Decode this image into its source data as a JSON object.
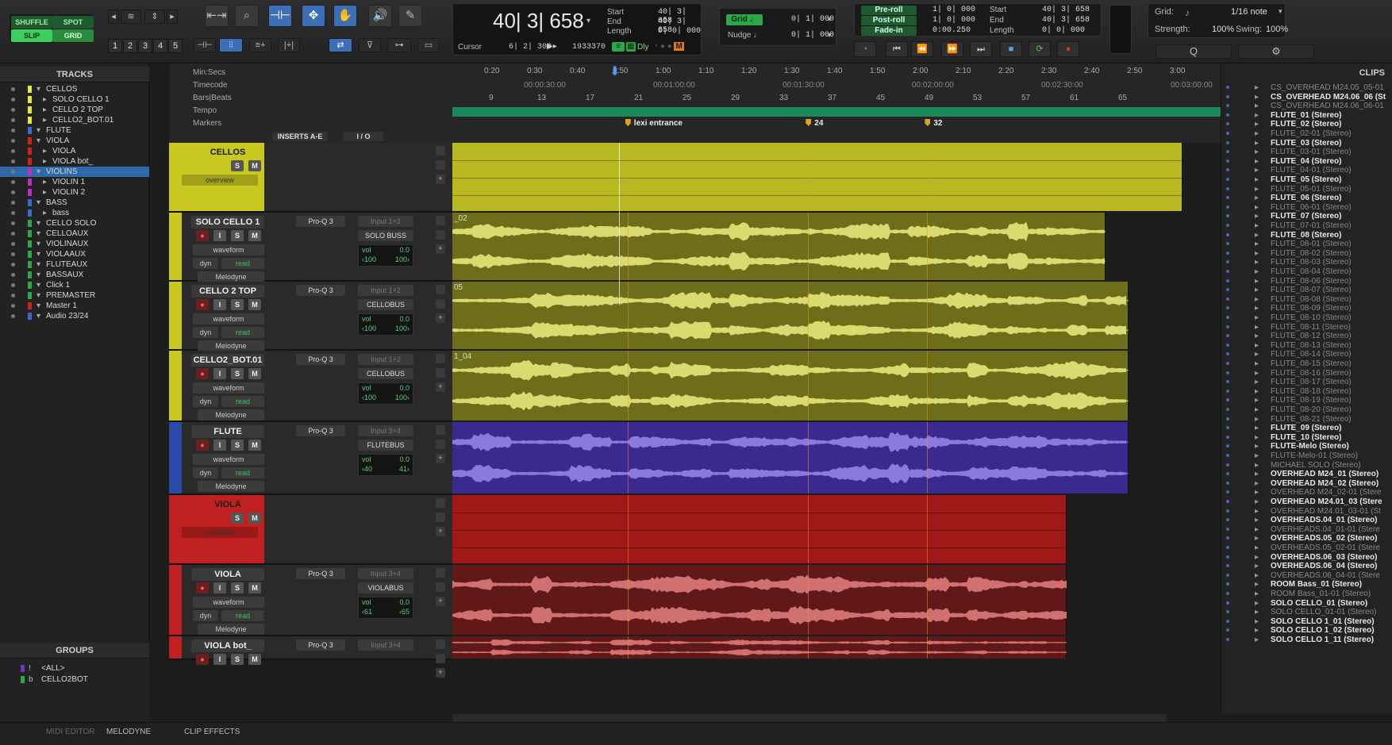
{
  "toolbar": {
    "modes": {
      "shuffle": "SHUFFLE",
      "spot": "SPOT",
      "slip": "SLIP",
      "grid": "GRID"
    },
    "zoom_presets": [
      "1",
      "2",
      "3",
      "4",
      "5"
    ],
    "main_counter": "40| 3| 658",
    "selection": {
      "start_label": "Start",
      "end_label": "End",
      "length_label": "Length",
      "start": "40| 3| 658",
      "end": "40| 3| 658",
      "length": "0| 0| 000"
    },
    "cursor_label": "Cursor",
    "cursor_value": "6| 2| 303",
    "cursor_samples": "1933370",
    "dly_label": "Dly",
    "grid_label": "Grid",
    "grid_value": "0| 1| 000",
    "nudge_label": "Nudge",
    "nudge_value": "0| 1| 000",
    "preroll_label": "Pre-roll",
    "postroll_label": "Post-roll",
    "fadein_label": "Fade-in",
    "preroll": "1| 0| 000",
    "postroll": "1| 0| 000",
    "fadein": "0:00.250",
    "transport_start_label": "Start",
    "transport_end_label": "End",
    "transport_length_label": "Length",
    "transport_start": "40| 3| 658",
    "transport_end": "40| 3| 658",
    "transport_length": "0| 0| 000",
    "grid_setting_label": "Grid:",
    "grid_setting_value": "1/16 note",
    "strength_label": "Strength:",
    "strength_value": "100%",
    "swing_label": "Swing:",
    "swing_value": "100%"
  },
  "tracks_panel": {
    "title": "TRACKS",
    "items": [
      {
        "name": "CELLOS",
        "color": "#e8e830",
        "indent": 0
      },
      {
        "name": "SOLO CELLO 1",
        "color": "#e8e830",
        "indent": 1
      },
      {
        "name": "CELLO 2 TOP",
        "color": "#e8e830",
        "indent": 1
      },
      {
        "name": "CELLO2_BOT.01",
        "color": "#e8e830",
        "indent": 1
      },
      {
        "name": "FLUTE",
        "color": "#3a6ad0",
        "indent": 0
      },
      {
        "name": "VIOLA",
        "color": "#d02020",
        "indent": 0
      },
      {
        "name": "VIOLA",
        "color": "#d02020",
        "indent": 1
      },
      {
        "name": "VIOLA bot_",
        "color": "#d02020",
        "indent": 1
      },
      {
        "name": "VIOLINS",
        "color": "#c030c0",
        "indent": 0,
        "selected": true
      },
      {
        "name": "VIOLIN 1",
        "color": "#c030c0",
        "indent": 1
      },
      {
        "name": "VIOLIN 2",
        "color": "#c030c0",
        "indent": 1
      },
      {
        "name": "BASS",
        "color": "#3a6ad0",
        "indent": 0
      },
      {
        "name": "bass",
        "color": "#3a6ad0",
        "indent": 1
      },
      {
        "name": "CELLO SOLO",
        "color": "#2aa84a",
        "indent": 0
      },
      {
        "name": "CELLOAUX",
        "color": "#2aa84a",
        "indent": 0
      },
      {
        "name": "VIOLINAUX",
        "color": "#2aa84a",
        "indent": 0
      },
      {
        "name": "VIOLAAUX",
        "color": "#2aa84a",
        "indent": 0
      },
      {
        "name": "FLUTEAUX",
        "color": "#2aa84a",
        "indent": 0
      },
      {
        "name": "BASSAUX",
        "color": "#2aa84a",
        "indent": 0
      },
      {
        "name": "Click 1",
        "color": "#2aa84a",
        "indent": 0
      },
      {
        "name": "PREMASTER",
        "color": "#2aa84a",
        "indent": 0
      },
      {
        "name": "Master 1",
        "color": "#d02020",
        "indent": 0
      },
      {
        "name": "Audio 23/24",
        "color": "#3a6ad0",
        "indent": 0
      }
    ]
  },
  "groups_panel": {
    "title": "GROUPS",
    "items": [
      {
        "key": "!",
        "name": "<ALL>",
        "color": "#7030d0"
      },
      {
        "key": "b",
        "name": "CELLO2BOT",
        "color": "#2aa84a"
      }
    ]
  },
  "rulers": {
    "labels": [
      "Min:Secs",
      "Timecode",
      "Bars|Beats",
      "Tempo",
      "Markers"
    ],
    "minsecs": [
      "0:20",
      "0:30",
      "0:40",
      "0:50",
      "1:00",
      "1:10",
      "1:20",
      "1:30",
      "1:40",
      "1:50",
      "2:00",
      "2:10",
      "2:20",
      "2:30",
      "2:40",
      "2:50",
      "3:00"
    ],
    "timecode": [
      "00:00:30:00",
      "00:01:00:00",
      "00:01:30:00",
      "00:02:00:00",
      "00:02:30:00",
      "00:03:00:00"
    ],
    "bars": [
      "9",
      "13",
      "17",
      "21",
      "25",
      "29",
      "33",
      "37",
      "45",
      "49",
      "53",
      "57",
      "61",
      "65"
    ],
    "markers": [
      {
        "name": "lexi entrance",
        "pos": 0.225
      },
      {
        "name": "24",
        "pos": 0.46
      },
      {
        "name": "32",
        "pos": 0.615
      }
    ],
    "inserts_header": "INSERTS A-E",
    "io_header": "I / O"
  },
  "tracks": [
    {
      "name": "CELLOS",
      "type": "folder",
      "color": "#c8c820",
      "clip_color": "#b8b820",
      "height": 88,
      "overview": "overview",
      "clip_end": 0.95
    },
    {
      "name": "SOLO CELLO 1",
      "type": "audio",
      "color": "#c8c820",
      "clip_color": "#6e6e1a",
      "wave_color": "#dada70",
      "height": 87,
      "insert": "Pro-Q 3",
      "input": "Input 1+2",
      "output": "SOLO BUSS",
      "view": "waveform",
      "auto": "dyn",
      "auto_mode": "read",
      "plugin": "Melodyne",
      "vol": "0.0",
      "pan_l": "‹100",
      "pan_r": "100›",
      "clip_label": "_02",
      "clip_end": 0.85
    },
    {
      "name": "CELLO 2 TOP",
      "type": "audio",
      "color": "#c8c820",
      "clip_color": "#6e6e1a",
      "wave_color": "#dada70",
      "height": 87,
      "insert": "Pro-Q 3",
      "input": "Input 1+2",
      "output": "CELLOBUS",
      "view": "waveform",
      "auto": "dyn",
      "auto_mode": "read",
      "plugin": "Melodyne",
      "vol": "0.0",
      "pan_l": "‹100",
      "pan_r": "100›",
      "clip_label": "05",
      "clip_end": 0.88
    },
    {
      "name": "CELLO2_BOT.01",
      "type": "audio",
      "color": "#c8c820",
      "clip_color": "#6e6e1a",
      "wave_color": "#dada70",
      "height": 90,
      "insert": "Pro-Q 3",
      "input": "Input 1+2",
      "output": "CELLOBUS",
      "view": "waveform",
      "auto": "dyn",
      "auto_mode": "read",
      "plugin": "Melodyne",
      "vol": "0.0",
      "pan_l": "‹100",
      "pan_r": "100›",
      "clip_label": "1_04",
      "clip_end": 0.88
    },
    {
      "name": "FLUTE",
      "type": "audio",
      "color": "#2a4aa8",
      "clip_color": "#3a2a90",
      "wave_color": "#8a7ae0",
      "height": 92,
      "insert": "Pro-Q 3",
      "input": "Input 3+4",
      "output": "FLUTEBUS",
      "view": "waveform",
      "auto": "dyn",
      "auto_mode": "read",
      "plugin": "Melodyne",
      "vol": "0.0",
      "pan_l": "‹40",
      "pan_r": "41›",
      "clip_label": "",
      "clip_end": 0.88
    },
    {
      "name": "VIOLA",
      "type": "folder",
      "color": "#c02020",
      "clip_color": "#a01818",
      "height": 88,
      "overview": "overview",
      "clip_end": 0.8
    },
    {
      "name": "VIOLA",
      "type": "audio",
      "color": "#c02020",
      "clip_color": "#601818",
      "wave_color": "#d07070",
      "height": 90,
      "insert": "Pro-Q 3",
      "input": "Input 3+4",
      "output": "VIOLABUS",
      "view": "waveform",
      "auto": "dyn",
      "auto_mode": "read",
      "plugin": "Melodyne",
      "vol": "0.0",
      "pan_l": "‹61",
      "pan_r": "‹65",
      "clip_label": "",
      "clip_end": 0.8
    },
    {
      "name": "VIOLA bot_",
      "type": "audio",
      "color": "#c02020",
      "clip_color": "#601818",
      "wave_color": "#d07070",
      "height": 30,
      "insert": "Pro-Q 3",
      "input": "Input 3+4",
      "output": "",
      "view": "",
      "auto": "",
      "auto_mode": "",
      "plugin": "",
      "vol": "",
      "pan_l": "",
      "pan_r": "",
      "clip_label": "",
      "clip_end": 0.8
    }
  ],
  "track_buttons": {
    "solo": "S",
    "mute": "M",
    "input": "I",
    "rec": "●"
  },
  "clips_panel": {
    "title": "CLIPS",
    "items": [
      {
        "name": "CS_OVERHEAD M24.05_05-01",
        "style": "dim"
      },
      {
        "name": "CS_OVERHEAD M24.06_06 (St",
        "style": "bold"
      },
      {
        "name": "CS_OVERHEAD M24.06_06-01",
        "style": "dim"
      },
      {
        "name": "FLUTE_01 (Stereo)",
        "style": "bold"
      },
      {
        "name": "FLUTE_02 (Stereo)",
        "style": "bold"
      },
      {
        "name": "FLUTE_02-01 (Stereo)",
        "style": "dim"
      },
      {
        "name": "FLUTE_03 (Stereo)",
        "style": "bold"
      },
      {
        "name": "FLUTE_03-01 (Stereo)",
        "style": "dim"
      },
      {
        "name": "FLUTE_04 (Stereo)",
        "style": "bold"
      },
      {
        "name": "FLUTE_04-01 (Stereo)",
        "style": "dim"
      },
      {
        "name": "FLUTE_05 (Stereo)",
        "style": "bold"
      },
      {
        "name": "FLUTE_05-01 (Stereo)",
        "style": "dim"
      },
      {
        "name": "FLUTE_06 (Stereo)",
        "style": "bold"
      },
      {
        "name": "FLUTE_06-01 (Stereo)",
        "style": "dim"
      },
      {
        "name": "FLUTE_07 (Stereo)",
        "style": "bold"
      },
      {
        "name": "FLUTE_07-01 (Stereo)",
        "style": "dim"
      },
      {
        "name": "FLUTE_08 (Stereo)",
        "style": "bold"
      },
      {
        "name": "FLUTE_08-01 (Stereo)",
        "style": "dim"
      },
      {
        "name": "FLUTE_08-02 (Stereo)",
        "style": "dim"
      },
      {
        "name": "FLUTE_08-03 (Stereo)",
        "style": "dim"
      },
      {
        "name": "FLUTE_08-04 (Stereo)",
        "style": "dim"
      },
      {
        "name": "FLUTE_08-06 (Stereo)",
        "style": "dim"
      },
      {
        "name": "FLUTE_08-07 (Stereo)",
        "style": "dim"
      },
      {
        "name": "FLUTE_08-08 (Stereo)",
        "style": "dim"
      },
      {
        "name": "FLUTE_08-09 (Stereo)",
        "style": "dim"
      },
      {
        "name": "FLUTE_08-10 (Stereo)",
        "style": "dim"
      },
      {
        "name": "FLUTE_08-11 (Stereo)",
        "style": "dim"
      },
      {
        "name": "FLUTE_08-12 (Stereo)",
        "style": "dim"
      },
      {
        "name": "FLUTE_08-13 (Stereo)",
        "style": "dim"
      },
      {
        "name": "FLUTE_08-14 (Stereo)",
        "style": "dim"
      },
      {
        "name": "FLUTE_08-15 (Stereo)",
        "style": "dim"
      },
      {
        "name": "FLUTE_08-16 (Stereo)",
        "style": "dim"
      },
      {
        "name": "FLUTE_08-17 (Stereo)",
        "style": "dim"
      },
      {
        "name": "FLUTE_08-18 (Stereo)",
        "style": "dim"
      },
      {
        "name": "FLUTE_08-19 (Stereo)",
        "style": "dim"
      },
      {
        "name": "FLUTE_08-20 (Stereo)",
        "style": "dim"
      },
      {
        "name": "FLUTE_08-21 (Stereo)",
        "style": "dim"
      },
      {
        "name": "FLUTE_09 (Stereo)",
        "style": "bold"
      },
      {
        "name": "FLUTE_10 (Stereo)",
        "style": "bold"
      },
      {
        "name": "FLUTE-Melo (Stereo)",
        "style": "bold"
      },
      {
        "name": "FLUTE-Melo-01 (Stereo)",
        "style": "dim"
      },
      {
        "name": "MICHAEL SOLO (Stereo)",
        "style": "dim"
      },
      {
        "name": "OVERHEAD M24_01 (Stereo)",
        "style": "bold"
      },
      {
        "name": "OVERHEAD M24_02 (Stereo)",
        "style": "bold"
      },
      {
        "name": "OVERHEAD M24_02-01 (Stere",
        "style": "dim"
      },
      {
        "name": "OVERHEAD M24.01_03 (Stere",
        "style": "bold"
      },
      {
        "name": "OVERHEAD M24.01_03-01 (St",
        "style": "dim"
      },
      {
        "name": "OVERHEADS.04_01 (Stereo)",
        "style": "bold"
      },
      {
        "name": "OVERHEADS.04_01-01 (Stere",
        "style": "dim"
      },
      {
        "name": "OVERHEADS.05_02 (Stereo)",
        "style": "bold"
      },
      {
        "name": "OVERHEADS.05_02-01 (Stere",
        "style": "dim"
      },
      {
        "name": "OVERHEADS.06_03 (Stereo)",
        "style": "bold"
      },
      {
        "name": "OVERHEADS.06_04 (Stereo)",
        "style": "bold"
      },
      {
        "name": "OVERHEADS.06_04-01 (Stere",
        "style": "dim"
      },
      {
        "name": "ROOM Bass_01 (Stereo)",
        "style": "bold"
      },
      {
        "name": "ROOM Bass_01-01 (Stereo)",
        "style": "dim"
      },
      {
        "name": "SOLO CELLO_01 (Stereo)",
        "style": "bold"
      },
      {
        "name": "SOLO CELLO_01-01 (Stereo)",
        "style": "dim"
      },
      {
        "name": "SOLO CELLO 1_01 (Stereo)",
        "style": "bold"
      },
      {
        "name": "SOLO CELLO 1_02 (Stereo)",
        "style": "bold"
      },
      {
        "name": "SOLO CELLO 1_11 (Stereo)",
        "style": "bold"
      }
    ]
  },
  "bottom_tabs": [
    "MIDI EDITOR",
    "MELODYNE",
    "CLIP EFFECTS"
  ]
}
